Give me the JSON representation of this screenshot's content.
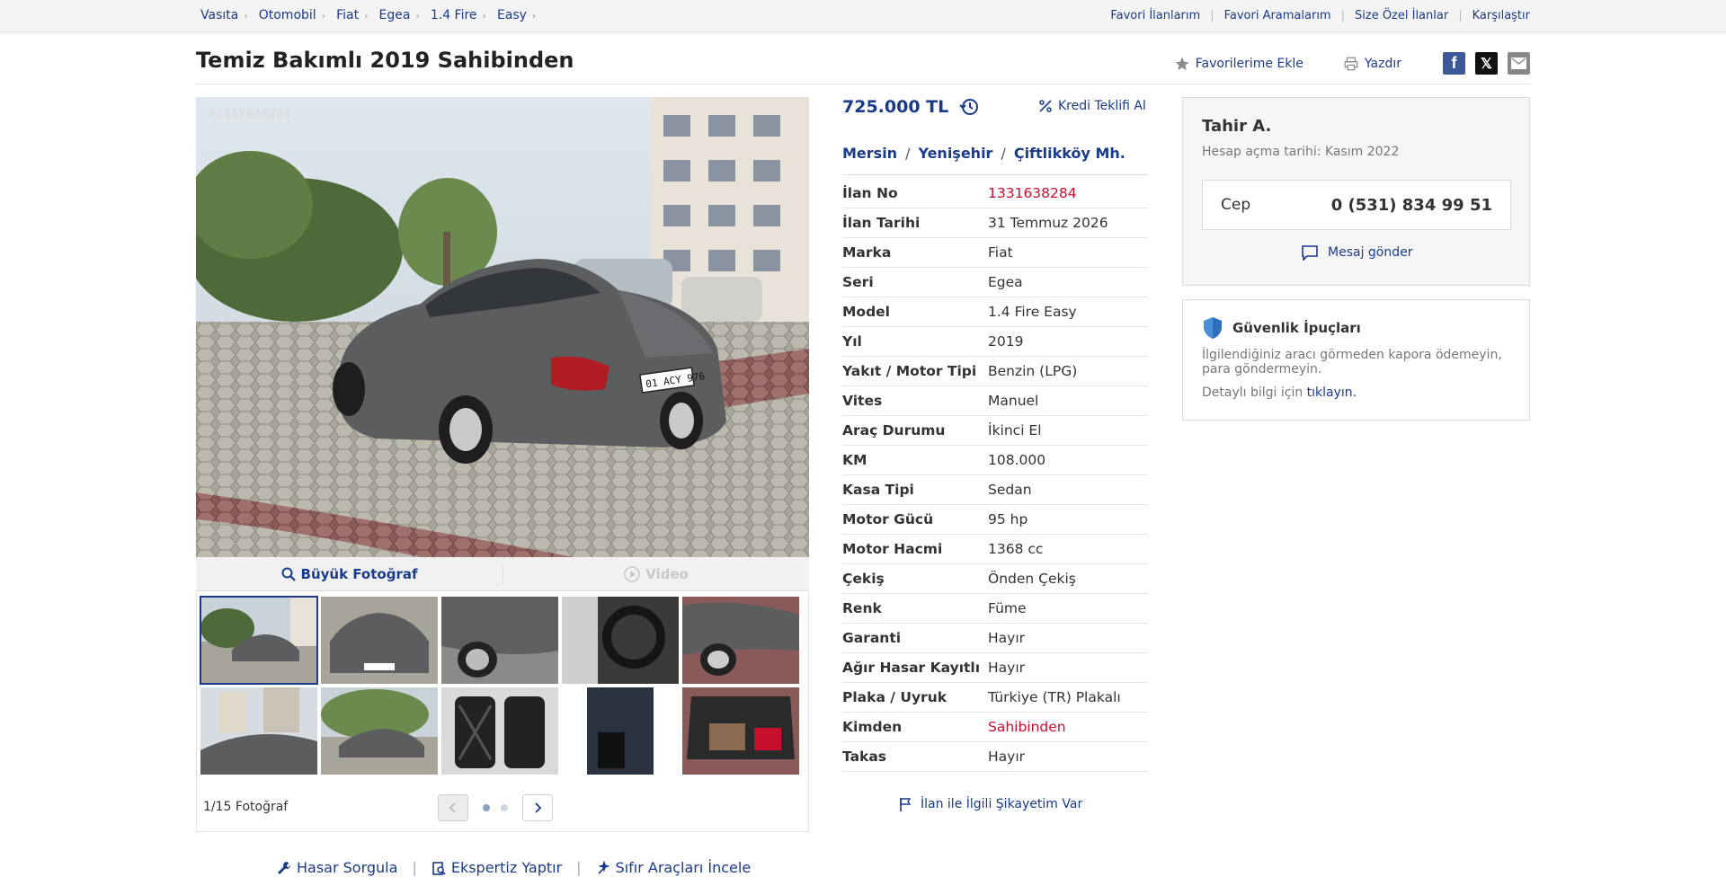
{
  "breadcrumbs": [
    "Vasıta",
    "Otomobil",
    "Fiat",
    "Egea",
    "1.4 Fire",
    "Easy"
  ],
  "top_links": [
    "Favori İlanlarım",
    "Favori Aramalarım",
    "Size Özel İlanlar",
    "Karşılaştır"
  ],
  "title": "Temiz Bakımlı 2019 Sahibinden",
  "actions": {
    "favorite": "Favorilerime Ekle",
    "print": "Yazdır"
  },
  "social": {
    "facebook": "f",
    "x": "𝕏"
  },
  "photo": {
    "id_label": "#1331638284",
    "tab_large": "Büyük Fotoğraf",
    "tab_video": "Video",
    "count_label": "1/15 Fotoğraf",
    "page_dots": 2,
    "active_page": 1,
    "thumbnails": [
      "thumb-1",
      "thumb-2",
      "thumb-3",
      "thumb-4",
      "thumb-5",
      "thumb-6",
      "thumb-7",
      "thumb-8",
      "thumb-9",
      "thumb-10"
    ]
  },
  "bottom_links": [
    "Hasar Sorgula",
    "Ekspertiz Yaptır",
    "Sıfır Araçları İncele"
  ],
  "price": "725.000 TL",
  "credit_link": "Kredi Teklifi Al",
  "location": [
    "Mersin",
    "Yenişehir",
    "Çiftlikköy Mh."
  ],
  "details": [
    {
      "label": "İlan No",
      "value": "1331638284",
      "highlight": true
    },
    {
      "label": "İlan Tarihi",
      "value": "31 Temmuz 2026"
    },
    {
      "label": "Marka",
      "value": "Fiat"
    },
    {
      "label": "Seri",
      "value": "Egea"
    },
    {
      "label": "Model",
      "value": "1.4 Fire Easy"
    },
    {
      "label": "Yıl",
      "value": "2019"
    },
    {
      "label": "Yakıt / Motor Tipi",
      "value": "Benzin (LPG)"
    },
    {
      "label": "Vites",
      "value": "Manuel"
    },
    {
      "label": "Araç Durumu",
      "value": "İkinci El"
    },
    {
      "label": "KM",
      "value": "108.000"
    },
    {
      "label": "Kasa Tipi",
      "value": "Sedan"
    },
    {
      "label": "Motor Gücü",
      "value": "95 hp"
    },
    {
      "label": "Motor Hacmi",
      "value": "1368 cc"
    },
    {
      "label": "Çekiş",
      "value": "Önden Çekiş"
    },
    {
      "label": "Renk",
      "value": "Füme"
    },
    {
      "label": "Garanti",
      "value": "Hayır"
    },
    {
      "label": "Ağır Hasar Kayıtlı",
      "value": "Hayır"
    },
    {
      "label": "Plaka / Uyruk",
      "value": "Türkiye (TR) Plakalı"
    },
    {
      "label": "Kimden",
      "value": "Sahibinden",
      "highlight": true
    },
    {
      "label": "Takas",
      "value": "Hayır"
    }
  ],
  "complaint": "İlan ile İlgili Şikayetim Var",
  "seller": {
    "name": "Tahir A.",
    "since": "Hesap açma tarihi: Kasım 2022",
    "phone_label": "Cep",
    "phone": "0 (531) 834 99 51",
    "message": "Mesaj gönder"
  },
  "safety": {
    "title": "Güvenlik İpuçları",
    "text": "İlgilendiğiniz aracı görmeden kapora ödemeyin, para göndermeyin.",
    "more_prefix": "Detaylı bilgi için",
    "more_link": "tıklayın."
  },
  "colors": {
    "link": "#1a3a8a",
    "highlight": "#c8102e",
    "car": "#5b5d5f"
  }
}
